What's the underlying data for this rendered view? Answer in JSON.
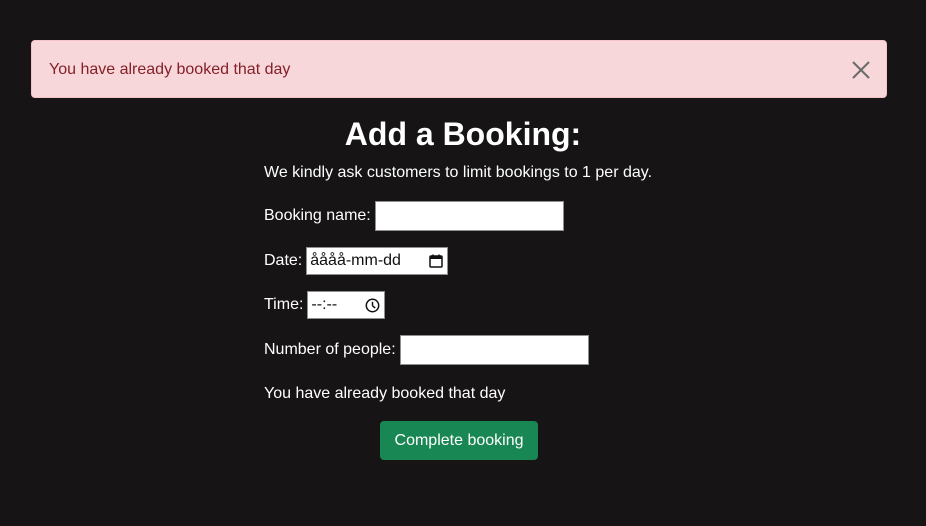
{
  "alert": {
    "message": "You have already booked that day",
    "close_icon": "close-icon"
  },
  "form": {
    "title": "Add a Booking:",
    "notice": "We kindly ask customers to limit bookings to 1 per day.",
    "booking_name_label": "Booking name:",
    "booking_name_value": "",
    "date_label": "Date:",
    "date_placeholder": "åååå-mm-dd",
    "date_icon": "calendar-icon",
    "time_label": "Time:",
    "time_placeholder": "--:--",
    "time_icon": "clock-icon",
    "people_label": "Number of people:",
    "people_value": "",
    "error_message": "You have already booked that day",
    "submit_label": "Complete booking"
  },
  "colors": {
    "background": "#161415",
    "alert_bg": "#f8d7da",
    "alert_text": "#842029",
    "button": "#198754"
  }
}
